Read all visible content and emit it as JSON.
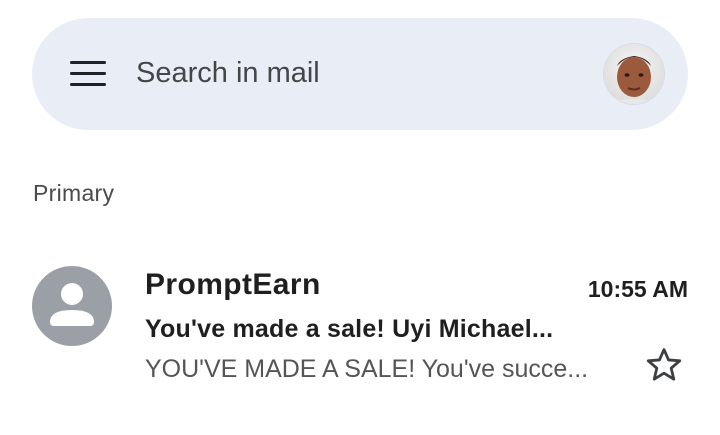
{
  "search": {
    "placeholder": "Search in mail"
  },
  "icons": {
    "menu": "hamburger-menu-icon",
    "profile": "profile-avatar",
    "sender_avatar": "person-icon",
    "star": "star-outline-icon"
  },
  "section": {
    "label": "Primary"
  },
  "emails": [
    {
      "sender": "PromptEarn",
      "time": "10:55 AM",
      "subject": "You've made a sale! Uyi Michael...",
      "snippet": "YOU'VE MADE A SALE! You've succe...",
      "unread": true,
      "starred": false
    }
  ],
  "colors": {
    "search_bar_bg": "#e9edf6",
    "avatar_gray": "#9aa0a6",
    "text_primary": "#1f1f1f"
  }
}
